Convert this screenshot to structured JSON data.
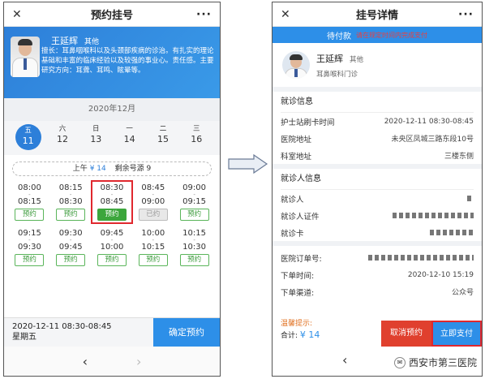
{
  "left": {
    "title": "预约挂号",
    "doctor": {
      "name": "王延辉",
      "title_tag": "其他",
      "intro": "擅长：耳鼻咽喉科以及头颈部疾病的诊治。有扎实的理论基础和丰富的临床经验以及较强的事业心。责任感。主要研究方向：耳聋、耳鸣、眩晕等。"
    },
    "month": "2020年12月",
    "days": [
      {
        "week": "五",
        "date": "11"
      },
      {
        "week": "六",
        "date": "12"
      },
      {
        "week": "日",
        "date": "13"
      },
      {
        "week": "一",
        "date": "14"
      },
      {
        "week": "二",
        "date": "15"
      },
      {
        "week": "三",
        "date": "16"
      }
    ],
    "quota": {
      "period": "上午",
      "price": "¥ 14",
      "remaining": "剩余号源 9"
    },
    "slots": [
      {
        "start": "08:00",
        "end": "08:15",
        "btn": "预约"
      },
      {
        "start": "08:15",
        "end": "08:30",
        "btn": "预约"
      },
      {
        "start": "08:30",
        "end": "08:45",
        "btn": "预约"
      },
      {
        "start": "08:45",
        "end": "09:00",
        "btn": "已约"
      },
      {
        "start": "09:00",
        "end": "09:15",
        "btn": "预约"
      },
      {
        "start": "09:15",
        "end": "09:30",
        "btn": "预约"
      },
      {
        "start": "09:30",
        "end": "09:45",
        "btn": "预约"
      },
      {
        "start": "09:45",
        "end": "10:00",
        "btn": "预约"
      },
      {
        "start": "10:00",
        "end": "10:15",
        "btn": "预约"
      },
      {
        "start": "10:15",
        "end": "10:30",
        "btn": "预约"
      }
    ],
    "footer": {
      "datetime": "2020-12-11  08:30-08:45",
      "weekday": "星期五",
      "confirm": "确定预约"
    }
  },
  "right": {
    "title": "挂号详情",
    "status": "待付款",
    "status_note": "请在规定时间内完成支付",
    "doctor": {
      "name": "王延辉",
      "title_tag": "其他",
      "dept": "耳鼻喉科门诊"
    },
    "visit": {
      "heading": "就诊信息",
      "rows": [
        {
          "label": "护士站刷卡时间",
          "value": "2020-12-11 08:30-08:45"
        },
        {
          "label": "医院地址",
          "value": "未央区凤城三路东段10号"
        },
        {
          "label": "科室地址",
          "value": "三楼东侧"
        }
      ]
    },
    "patient": {
      "heading": "就诊人信息",
      "rows": [
        {
          "label": "就诊人"
        },
        {
          "label": "就诊人证件"
        },
        {
          "label": "就诊卡"
        }
      ]
    },
    "order": {
      "rows": [
        {
          "label": "医院订单号:",
          "value": ""
        },
        {
          "label": "下单时间:",
          "value": "2020-12-10 15:19"
        },
        {
          "label": "下单渠道:",
          "value": "公众号"
        }
      ]
    },
    "footer": {
      "tip": "温馨提示:",
      "total_label": "合计:",
      "total": "¥ 14",
      "cancel": "取消预约",
      "pay": "立即支付"
    },
    "watermark": "西安市第三医院"
  },
  "icons": {
    "close": "close-icon",
    "more": "more-icon",
    "back": "back-icon",
    "forward": "forward-icon",
    "arrow": "right-arrow-icon"
  }
}
